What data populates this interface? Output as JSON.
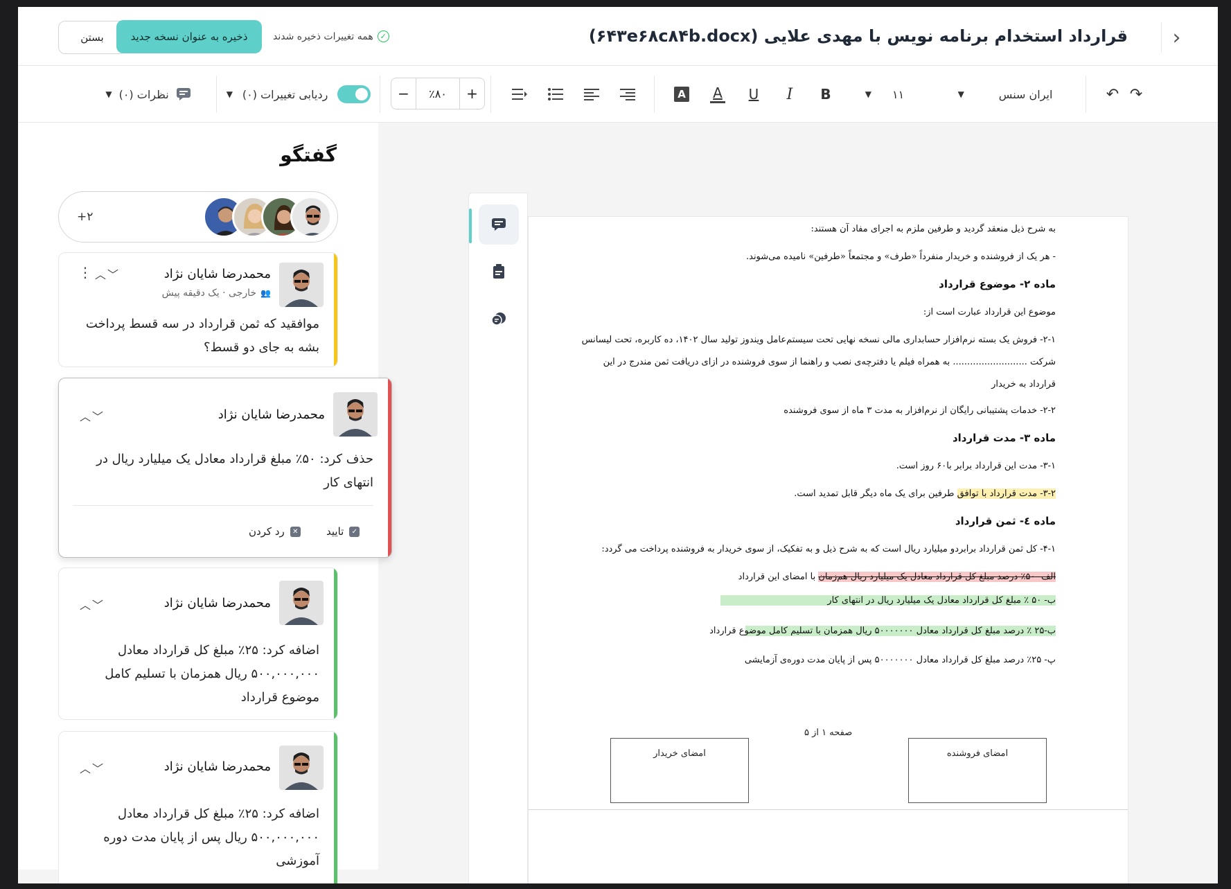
{
  "header": {
    "title": "قرارداد استخدام برنامه نویس با مهدی علایی (۶۴۳e۶۸c۸۴b.docx)",
    "save_new_label": "ذخیره به عنوان نسخه جدید",
    "close_label": "بستن",
    "saved_status": "همه تغییرات ذخیره شدند"
  },
  "toolbar": {
    "font_family": "ایران سنس",
    "font_size": "۱۱",
    "zoom": "٪۸۰",
    "track_changes_label": "ردیابی تغییرات (۰)",
    "comments_label": "نظرات (۰)",
    "track_changes_on": true
  },
  "panel": {
    "title": "گفتگو",
    "extra_participants": "+۲",
    "cards": [
      {
        "author": "محمدرضا شایان نژاد",
        "meta": "خارجی · یک دقیقه پیش",
        "body": "موافقید که ثمن قرارداد در سه قسط پرداخت بشه به جای دو قسط؟",
        "accent": "#f5c518"
      },
      {
        "author": "محمدرضا شایان نژاد",
        "body": "حذف کرد: ۵۰٪ مبلغ قرارداد معادل یک میلیارد ریال در انتهای کار",
        "accept_label": "تایید",
        "reject_label": "رد کردن",
        "accent": "#e05252"
      },
      {
        "author": "محمدرضا شایان نژاد",
        "body": "اضافه کرد: ۲۵٪ مبلغ کل قرارداد معادل ۵۰۰,۰۰۰,۰۰۰ ریال همزمان با تسلیم کامل موضوع قرارداد",
        "accent": "#5cbf6a"
      },
      {
        "author": "محمدرضا شایان نژاد",
        "body": "اضافه کرد: ۲۵٪ مبلغ کل قرارداد معادل ۵۰۰,۰۰۰,۰۰۰ ریال پس از پایان مدت دوره آموزشی",
        "accent": "#5cbf6a"
      }
    ]
  },
  "document": {
    "lines": {
      "l1": "به شرح ذیل منعقد گردید و طرفین ملزم به اجرای مفاد آن هستند:",
      "l2": "- هر یک از فروشنده و خریدار منفرداً «طرف» و مجتمعاً «طرفین» نامیده می‌شوند.",
      "h2": "ماده ۲- موضوع قرارداد",
      "l3": "موضوع این قرارداد عبارت است از:",
      "l4": "۲-۱- فروش یک بسته نرم‌افزار حسابداری مالی  نسخه نهایی تحت سیستم‌عامل ویندوز تولید سال ۱۴۰۲، ده کاربره، تحت لیسانس",
      "l5": "شرکت .......................... به همراه فیلم یا دفترچه‌ی نصب و راهنما  از سوی فروشنده در ازای دریافت ثمن مندرج در این",
      "l6": "قرارداد به خریدار",
      "l7": "۲-۲- خدمات پشتیبانی رایگان از نرم‌افزار به مدت ۳ ماه از سوی فروشنده",
      "h3": "ماده ۳- مدت قرارداد",
      "l8": "۳-۱- مدت این قرارداد برابر با۶۰ روز است.",
      "l9a": "۳-۲- مدت قرارداد با توافق",
      "l9b": " طرفین برای یک ماه دیگر قابل تمدید است.",
      "h4": "ماده ٤- ثمن قرارداد",
      "l10": "۴-۱- کل ثمن قرارداد برابردو میلیارد ریال است که به شرح ذیل و به تفکیک، از سوی خریدار به فروشنده پرداخت می گردد:",
      "l11a": "الف- ۵۰٪ درصد مبلغ کل قرارداد معادل یک میلیارد ریال هم‌زمان",
      "l11b": " با امضای این قرارداد",
      "l12": "ب- ۵۰ ٪ مبلغ کل قرارداد معادل یک میلیارد ریال در انتهای کار",
      "l13": "ب-۲۵ ٪ درصد مبلغ کل قرارداد معادل ۵۰۰۰۰۰۰۰ ریال همزمان با تسلیم کامل موضوع قرارداد",
      "l14": "پ- ۲۵٪ درصد مبلغ کل قرارداد معادل ۵۰۰۰۰۰۰۰ پس از پایان مدت دوره‌ی آزمایشی"
    },
    "page_number": "صفحه ۱ از ۵",
    "sig_seller": "امضای فروشنده",
    "sig_buyer": "امضای خریدار"
  }
}
